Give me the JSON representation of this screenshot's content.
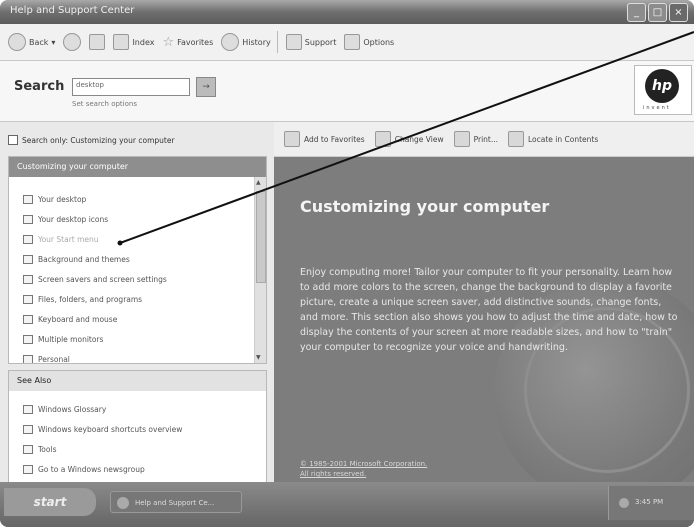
{
  "window": {
    "title": "Help and Support Center"
  },
  "toolbar": {
    "back": "Back",
    "index": "Index",
    "favorites": "Favorites",
    "history": "History",
    "support": "Support",
    "options": "Options"
  },
  "search": {
    "label": "Search",
    "value": "desktop",
    "options_link": "Set search options",
    "go": "→"
  },
  "logo": {
    "mark": "hp",
    "tagline": "invent"
  },
  "left": {
    "search_only": "Search only: Customizing your computer",
    "panel_title": "Customizing your computer",
    "topics": [
      "Your desktop",
      "Your desktop icons",
      "Your Start menu",
      "Background and themes",
      "Screen savers and screen settings",
      "Files, folders, and programs",
      "Keyboard and mouse",
      "Multiple monitors",
      "Personal"
    ],
    "see_also_title": "See Also",
    "see_also": [
      "Windows Glossary",
      "Windows keyboard shortcuts overview",
      "Tools",
      "Go to a Windows newsgroup"
    ]
  },
  "right_toolbar": {
    "add_fav": "Add to Favorites",
    "change_view": "Change View",
    "print": "Print...",
    "locate": "Locate in Contents"
  },
  "content": {
    "title": "Customizing your computer",
    "body": "Enjoy computing more! Tailor your computer to fit your personality. Learn how to add more colors to the screen, change the background to display a favorite picture, create a unique screen saver, add distinctive sounds, change fonts, and more. This section also shows you how to adjust the time and date, how to display the contents of your screen at more readable sizes, and how to \"train\" your computer to recognize your voice and handwriting.",
    "footer_line1": "© 1985-2001 Microsoft Corporation.",
    "footer_line2": "All rights reserved."
  },
  "taskbar": {
    "start": "start",
    "item": "Help and Support Ce...",
    "clock": "3:45 PM"
  }
}
